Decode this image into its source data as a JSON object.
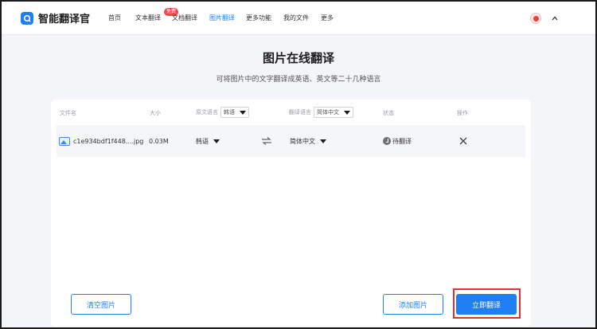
{
  "header": {
    "app_name": "智能翻译官",
    "nav": [
      {
        "label": "首页",
        "active": false
      },
      {
        "label": "文本翻译",
        "active": false,
        "badge": "免费"
      },
      {
        "label": "文档翻译",
        "active": false
      },
      {
        "label": "图片翻译",
        "active": true
      },
      {
        "label": "更多功能",
        "active": false
      },
      {
        "label": "我的文件",
        "active": false
      },
      {
        "label": "更多",
        "active": false
      }
    ]
  },
  "page": {
    "title": "图片在线翻译",
    "subtitle": "可将图片中的文字翻译成英语、英文等二十几种语言"
  },
  "table": {
    "columns": {
      "file_name": "文件名",
      "size": "大小",
      "source_lang": "原文语言",
      "source_lang_value": "韩语",
      "target_lang": "翻译语言",
      "target_lang_value": "简体中文",
      "status": "状态",
      "action": "操作"
    },
    "rows": [
      {
        "file_name": "c1e934bdf1f448....jpg",
        "size": "0.03M",
        "source_lang": "韩语",
        "target_lang": "简体中文",
        "status": "待翻译"
      }
    ]
  },
  "buttons": {
    "clear": "清空图片",
    "add": "添加图片",
    "translate": "立即翻译"
  },
  "colors": {
    "accent": "#1f7ef2",
    "badge": "#f04848",
    "highlight": "#e0312c"
  }
}
